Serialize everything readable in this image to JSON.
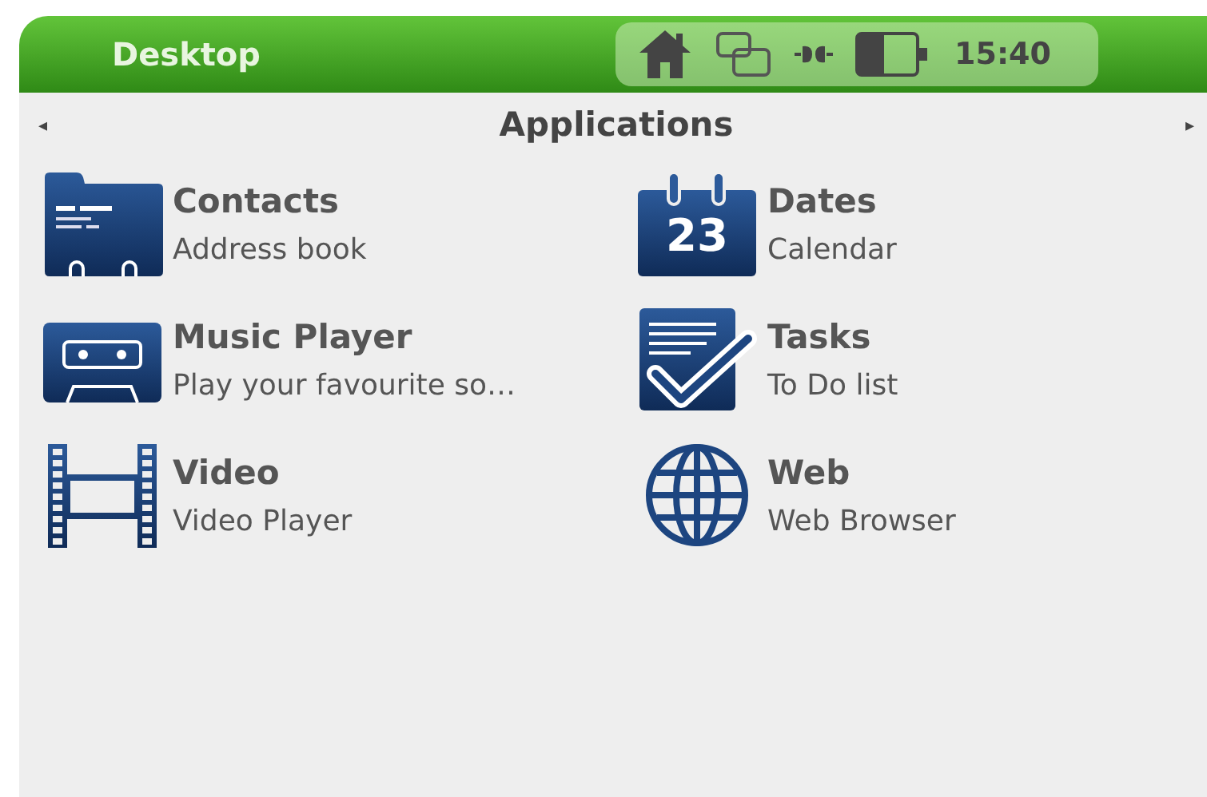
{
  "top_bar": {
    "title": "Desktop",
    "clock": "15:40"
  },
  "header": {
    "prev_arrow": "◂",
    "title": "Applications",
    "next_arrow": "▸"
  },
  "apps": [
    {
      "kind": "contacts",
      "name": "Contacts",
      "description": "Address book"
    },
    {
      "kind": "calendar",
      "name": "Dates",
      "description": "Calendar",
      "icon_text": "23"
    },
    {
      "kind": "music",
      "name": "Music Player",
      "description": "Play your favourite so…"
    },
    {
      "kind": "tasks",
      "name": "Tasks",
      "description": "To Do list"
    },
    {
      "kind": "video",
      "name": "Video",
      "description": "Video Player"
    },
    {
      "kind": "web",
      "name": "Web",
      "description": "Web Browser"
    }
  ]
}
